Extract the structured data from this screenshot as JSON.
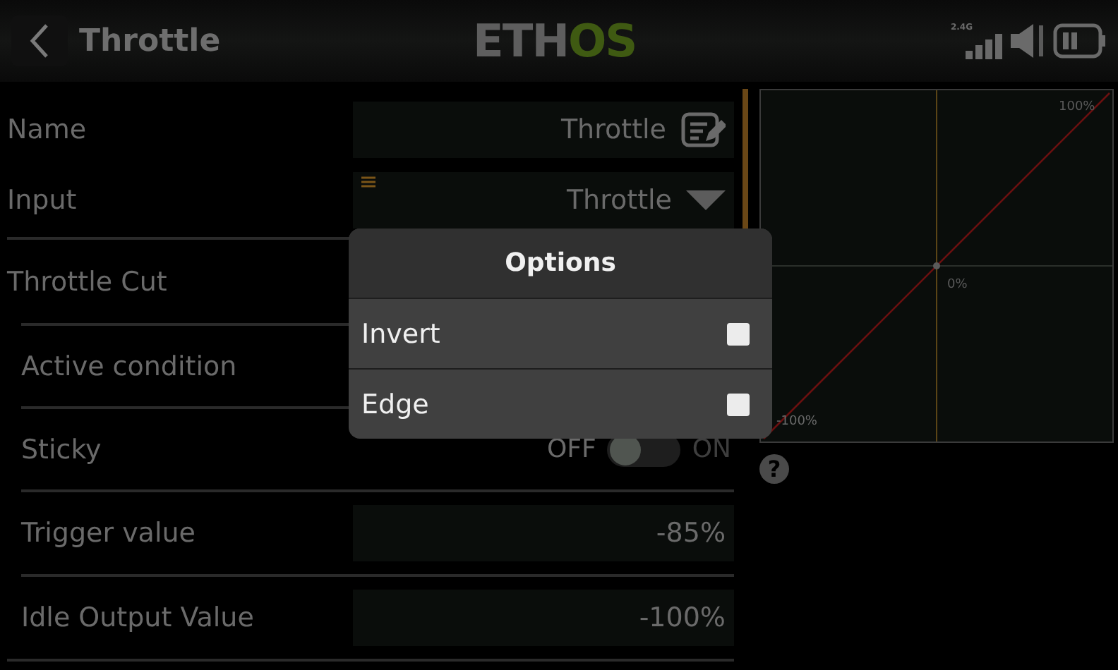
{
  "header": {
    "title": "Throttle",
    "logo": [
      "ETH",
      "OS"
    ],
    "band": "2.4G"
  },
  "rows": [
    {
      "kind": "field",
      "label": "Name",
      "value": "Throttle"
    },
    {
      "kind": "select",
      "label": "Input",
      "value": "Throttle"
    },
    {
      "kind": "heading",
      "label": "Throttle Cut"
    },
    {
      "kind": "sub",
      "label": "Active condition"
    },
    {
      "kind": "toggle",
      "label": "Sticky",
      "off": "OFF",
      "on": "ON",
      "checked": false
    },
    {
      "kind": "subfield",
      "label": "Trigger value",
      "value": "-85%"
    },
    {
      "kind": "subfield",
      "label": "Idle Output Value",
      "value": "-100%"
    }
  ],
  "curve": {
    "labels": [
      "100%",
      "0%",
      "-100%"
    ]
  },
  "help": "?",
  "dialog": {
    "title": "Options",
    "options": [
      {
        "label": "Invert",
        "checked": false
      },
      {
        "label": "Edge",
        "checked": false
      }
    ]
  }
}
